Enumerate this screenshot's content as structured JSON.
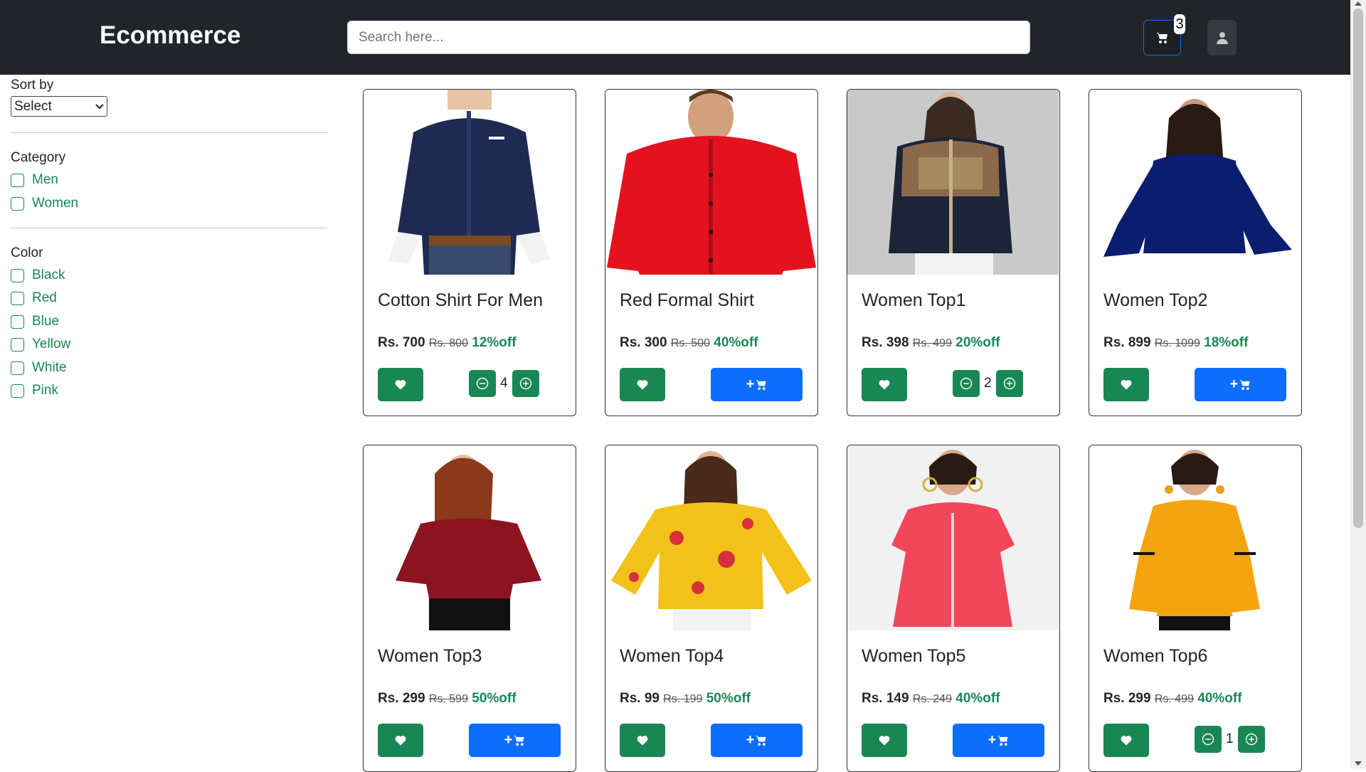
{
  "header": {
    "brand": "Ecommerce",
    "search_placeholder": "Search here...",
    "cart_count": "3",
    "icons": {
      "cart": "cart-icon",
      "user": "user-icon"
    }
  },
  "sidebar": {
    "sort_label": "Sort by",
    "sort_value": "Select",
    "category_title": "Category",
    "categories": [
      "Men",
      "Women"
    ],
    "color_title": "Color",
    "colors": [
      "Black",
      "Red",
      "Blue",
      "Yellow",
      "White",
      "Pink"
    ]
  },
  "colors": {
    "navbar": "#212529",
    "primary": "#0d6efd",
    "success": "#198754"
  },
  "products": [
    {
      "title": "Cotton Shirt For Men",
      "price": "Rs. 700",
      "mrp": "Rs. 800",
      "off": "12%off",
      "qty": "4"
    },
    {
      "title": "Red Formal Shirt",
      "price": "Rs. 300",
      "mrp": "Rs. 500",
      "off": "40%off",
      "add_label": "+"
    },
    {
      "title": "Women Top1",
      "price": "Rs. 398",
      "mrp": "Rs. 499",
      "off": "20%off",
      "qty": "2"
    },
    {
      "title": "Women Top2",
      "price": "Rs. 899",
      "mrp": "Rs. 1099",
      "off": "18%off",
      "add_label": "+"
    },
    {
      "title": "Women Top3",
      "price": "Rs. 299",
      "mrp": "Rs. 599",
      "off": "50%off",
      "add_label": "+"
    },
    {
      "title": "Women Top4",
      "price": "Rs. 99",
      "mrp": "Rs. 199",
      "off": "50%off",
      "add_label": "+"
    },
    {
      "title": "Women Top5",
      "price": "Rs. 149",
      "mrp": "Rs. 249",
      "off": "40%off",
      "add_label": "+"
    },
    {
      "title": "Women Top6",
      "price": "Rs. 299",
      "mrp": "Rs. 499",
      "off": "40%off",
      "qty": "1"
    }
  ]
}
